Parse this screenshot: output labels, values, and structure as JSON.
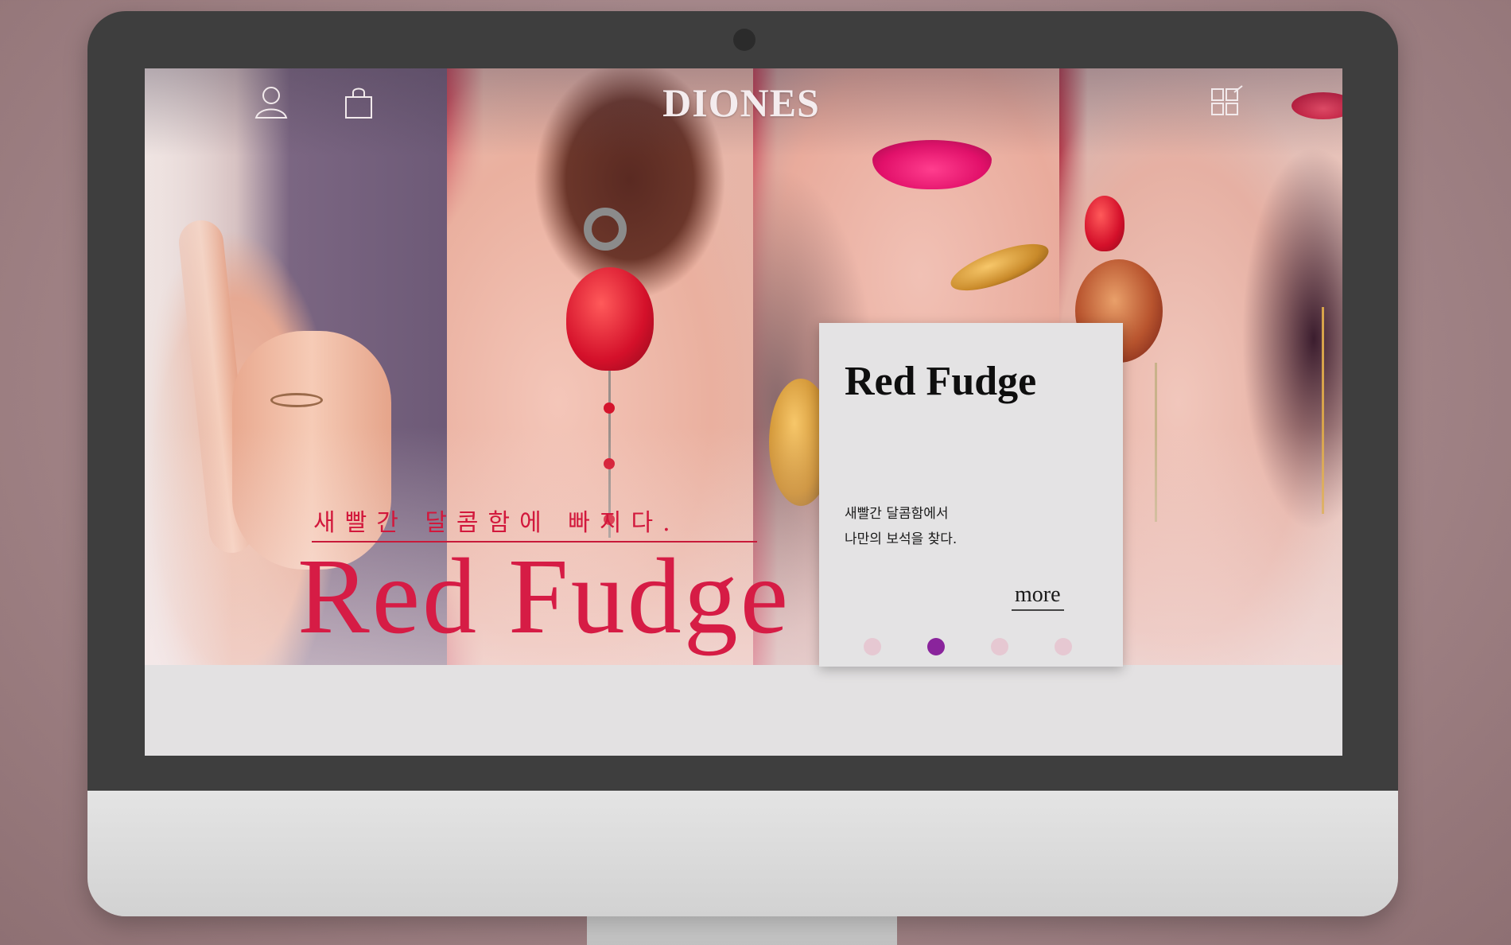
{
  "header": {
    "brand": "DIONES",
    "icons": [
      "user-icon",
      "shopping-bag-icon",
      "menu-grid-icon"
    ]
  },
  "hero": {
    "tagline": "새빨간 달콤함에 빠지다.",
    "title": "Red Fudge"
  },
  "card": {
    "title": "Red Fudge",
    "description_lines": [
      "새빨간 달콤함에서",
      "나만의 보석을 찾다."
    ],
    "more_label": "more",
    "carousel": {
      "total": 4,
      "active_index": 1
    }
  },
  "colors": {
    "accent_red": "#d61c45",
    "active_dot": "#8a249c",
    "inactive_dot": "#e6c8d2",
    "card_bg": "#e4e3e4"
  }
}
